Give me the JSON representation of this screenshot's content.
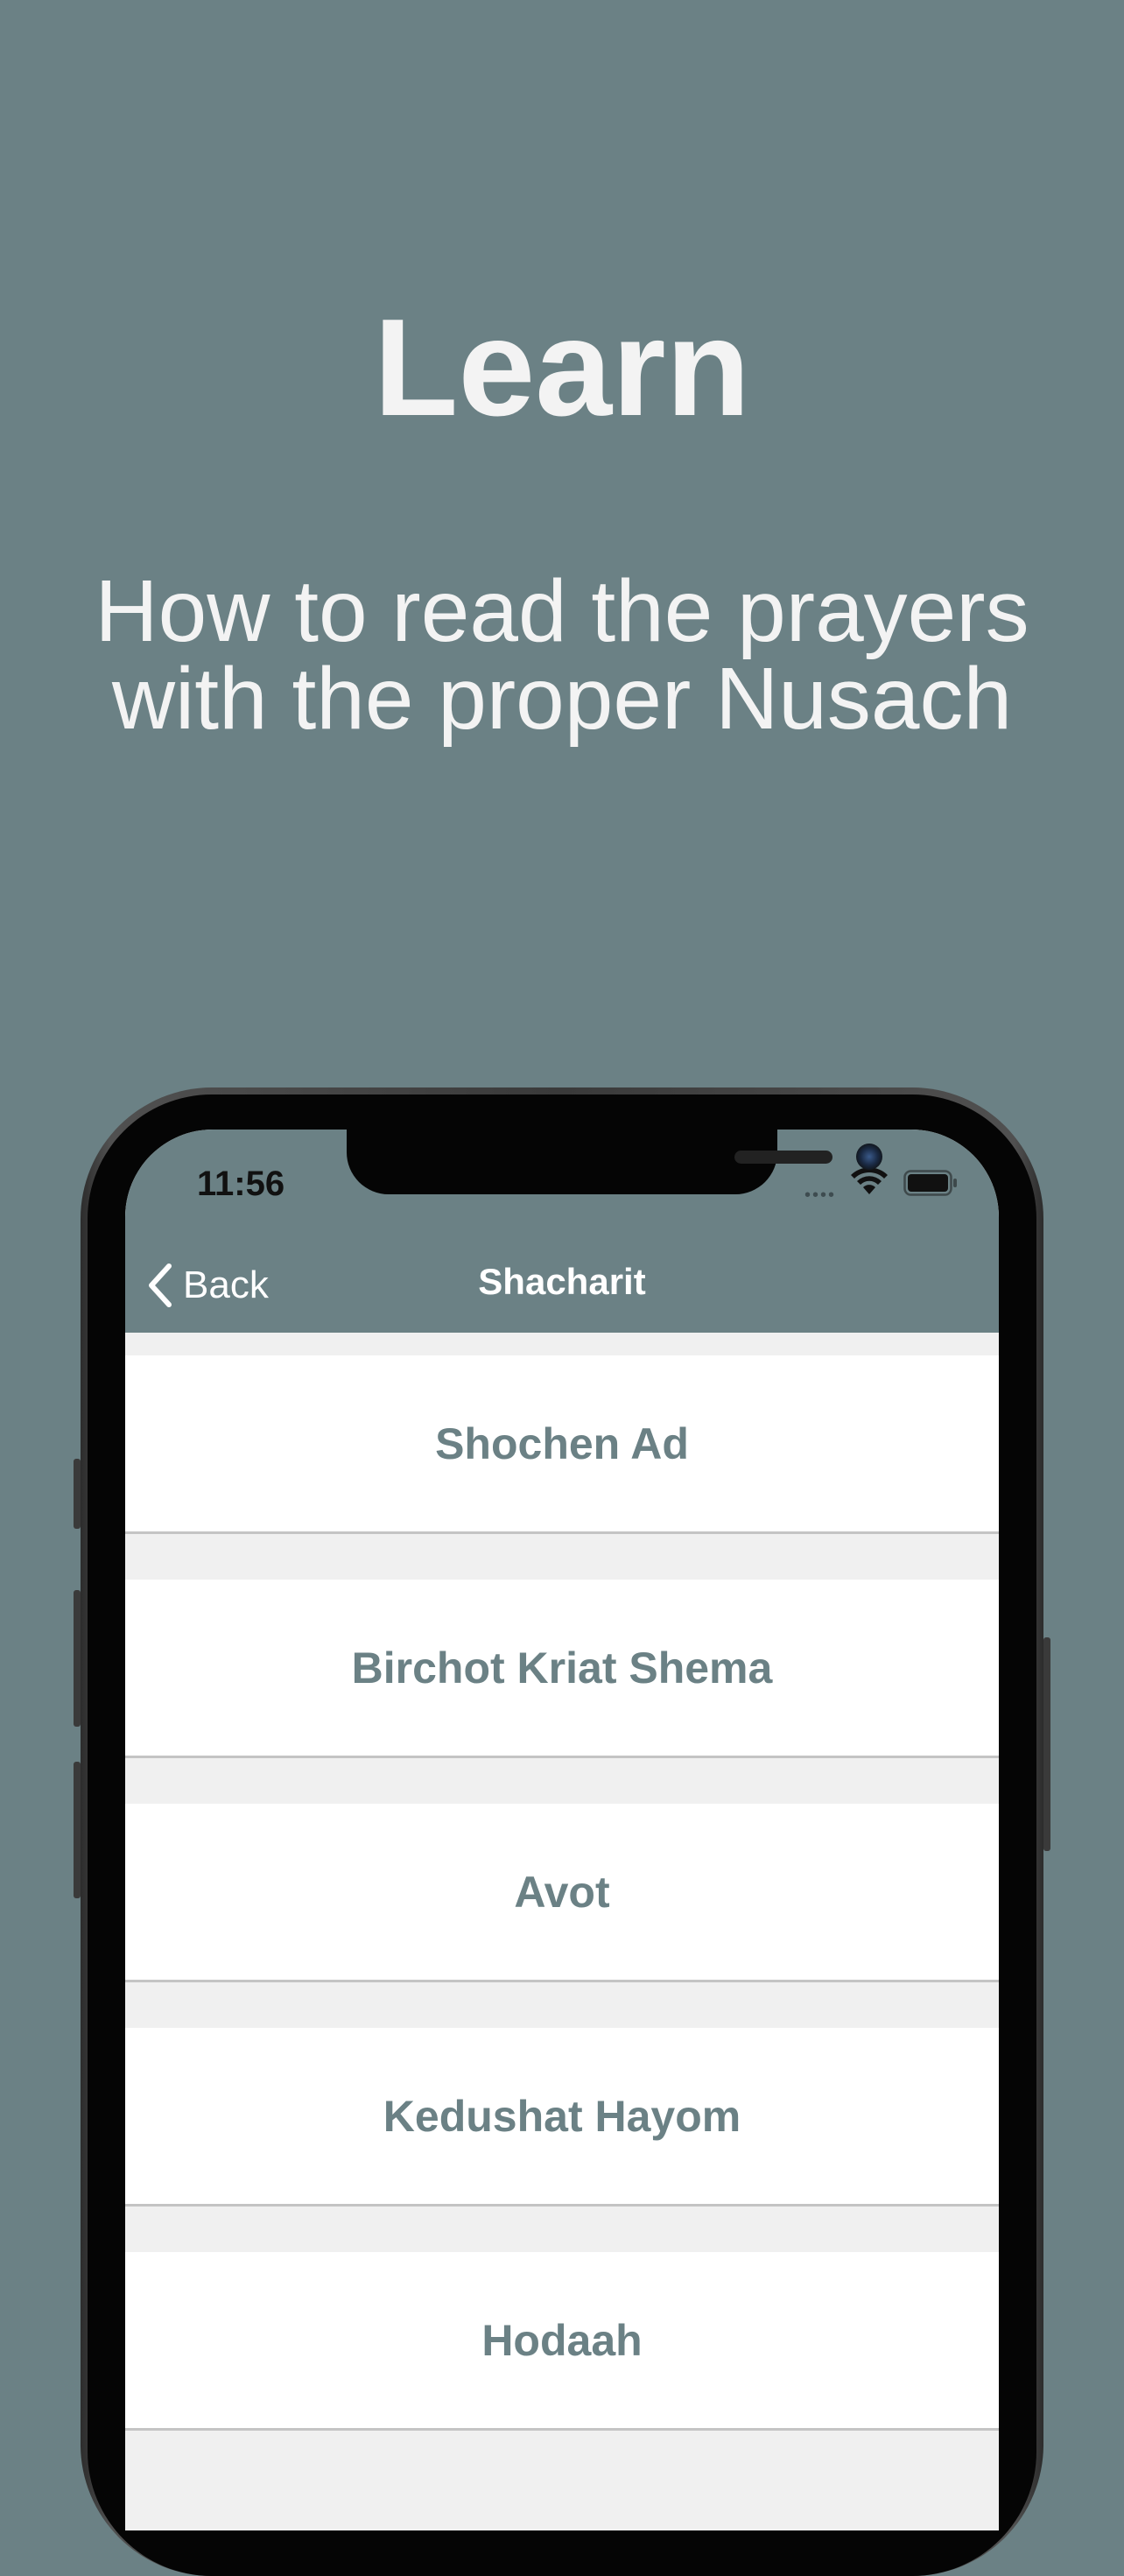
{
  "promo": {
    "title": "Learn",
    "subtitle_line1": "How to read the prayers",
    "subtitle_line2": "with the proper Nusach"
  },
  "status_bar": {
    "time": "11:56",
    "signal_icon": "signal-dots-icon",
    "wifi_icon": "wifi-icon",
    "battery_icon": "battery-icon"
  },
  "nav": {
    "back_label": "Back",
    "back_icon": "chevron-left-icon",
    "title": "Shacharit"
  },
  "list": {
    "items": [
      {
        "label": "Shochen Ad"
      },
      {
        "label": "Birchot Kriat Shema"
      },
      {
        "label": "Avot"
      },
      {
        "label": "Kedushat Hayom"
      },
      {
        "label": "Hodaah"
      }
    ]
  },
  "colors": {
    "background": "#6b8185",
    "accent_text": "#6b8185",
    "promo_text": "#f3f3f3",
    "list_background": "#ffffff",
    "separator": "#f0f0f0"
  }
}
